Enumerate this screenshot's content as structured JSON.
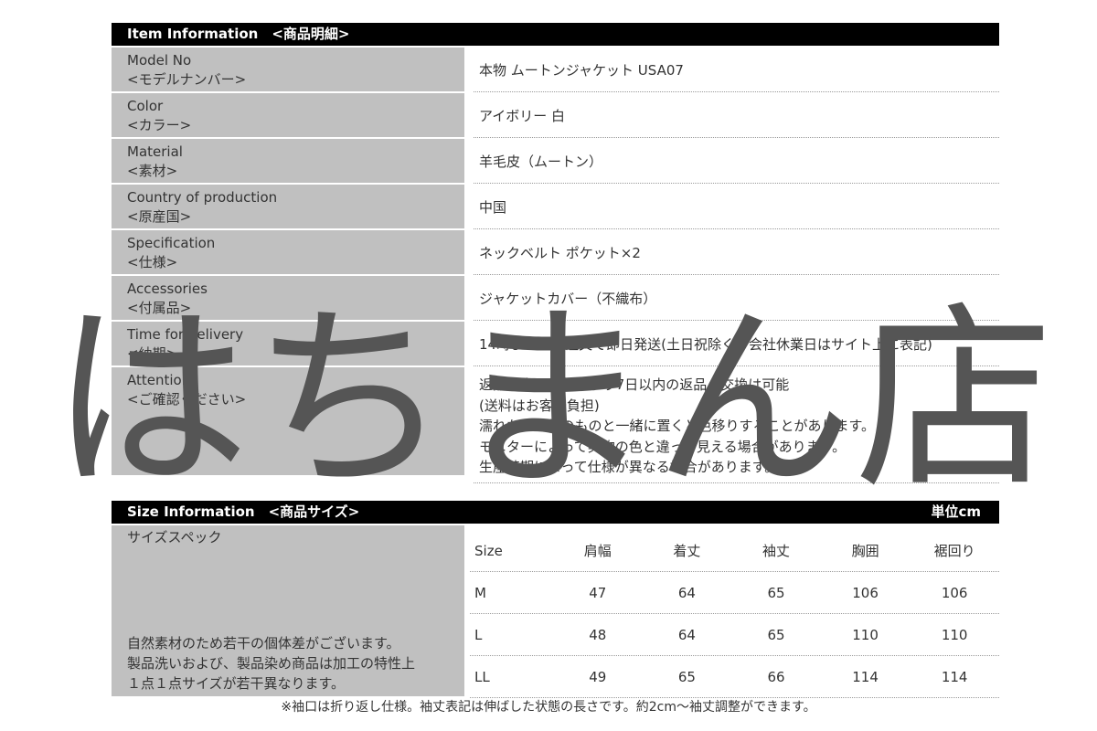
{
  "item_header": "Item Information　<商品明細>",
  "items": [
    {
      "label_en": "Model No",
      "label_ja": "<モデルナンバー>",
      "value": [
        "本物 ムートンジャケット USA07"
      ]
    },
    {
      "label_en": "Color",
      "label_ja": "<カラー>",
      "value": [
        "アイボリー 白"
      ]
    },
    {
      "label_en": "Material",
      "label_ja": "<素材>",
      "value": [
        "羊毛皮（ムートン）"
      ]
    },
    {
      "label_en": "Country of production",
      "label_ja": "<原産国>",
      "value": [
        "中国"
      ]
    },
    {
      "label_en": "Specification",
      "label_ja": "<仕様>",
      "value": [
        "ネックベルト ポケット×2"
      ]
    },
    {
      "label_en": "Accessories",
      "label_ja": "<付属品>",
      "value": [
        "ジャケットカバー（不織布）"
      ]
    },
    {
      "label_en": "Time for delivery",
      "label_ja": "<納期>",
      "value": [
        "14時までのご注文で即日発送(土日祝除く・会社休業日はサイト上に表記)"
      ]
    },
    {
      "label_en": "Attention",
      "label_ja": "<ご確認ください>",
      "value": [
        "返品：商品到着日より7日以内の返品・交換は可能",
        "(送料はお客様負担)",
        "濡れたまま他のものと一緒に置くと色移りすることがあります。",
        "モニターによって実物の色と違って見える場合があります。",
        "生産時期によって仕様が異なる場合があります。"
      ]
    }
  ],
  "size_header": "Size Information　<商品サイズ>",
  "unit": "単位cm",
  "size_title": "サイズスペック",
  "size_note": [
    "自然素材のため若干の個体差がございます。",
    "製品洗いおよび、製品染め商品は加工の特性上",
    "１点１点サイズが若干異なります。"
  ],
  "size_columns": [
    "Size",
    "肩幅",
    "着丈",
    "袖丈",
    "胸囲",
    "裾回り"
  ],
  "size_rows": [
    [
      "M",
      "47",
      "64",
      "65",
      "106",
      "106"
    ],
    [
      "L",
      "48",
      "64",
      "65",
      "110",
      "110"
    ],
    [
      "LL",
      "49",
      "65",
      "66",
      "114",
      "114"
    ]
  ],
  "footnote": "※袖口は折り返し仕様。袖丈表記は伸ばした状態の長さです。約2cm〜袖丈調整ができます。",
  "watermark": "はちまん店"
}
